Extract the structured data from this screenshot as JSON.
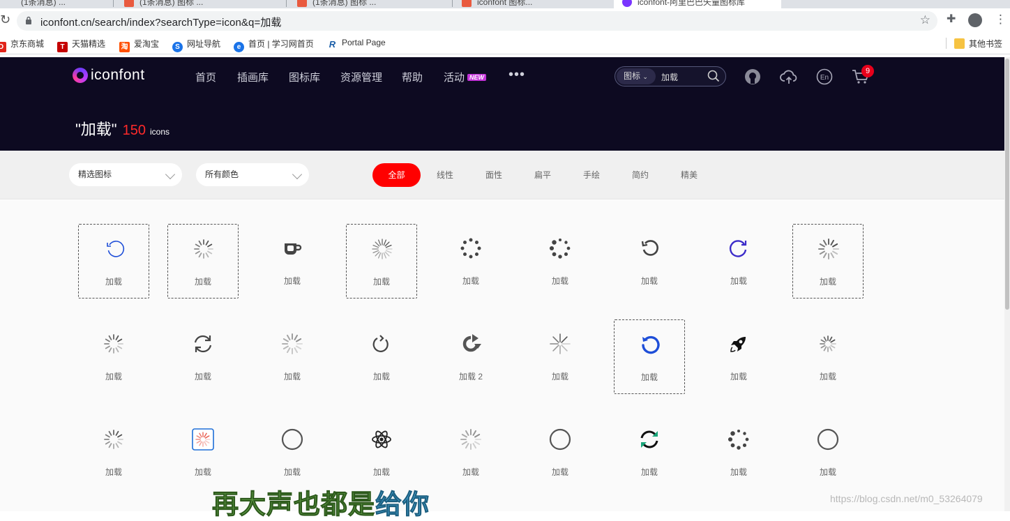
{
  "browser": {
    "tabs": [
      {
        "title": "(1条消息) ..."
      },
      {
        "title": "(1条消息) 图标 ..."
      },
      {
        "title": "(1条消息) 图标 ..."
      },
      {
        "title": "iconfont 图标..."
      },
      {
        "title": "iconfont-阿里巴巴矢量图标库"
      }
    ],
    "url": "iconfont.cn/search/index?searchType=icon&q=加载"
  },
  "bookmarks": [
    {
      "label": "京东商城",
      "icon": "jd-icon",
      "color": "#e1251b"
    },
    {
      "label": "天猫精选",
      "icon": "tmall-icon",
      "color": "#c40000"
    },
    {
      "label": "爱淘宝",
      "icon": "aitaobao-icon",
      "color": "#ff5000"
    },
    {
      "label": "网址导航",
      "icon": "nav-icon",
      "color": "#1a73e8"
    },
    {
      "label": "首页 | 学习网首页",
      "icon": "study-icon",
      "color": "#1a73e8"
    },
    {
      "label": "Portal Page",
      "icon": "portal-icon",
      "color": "#1a5ea8"
    }
  ],
  "bookmarks_other": "其他书签",
  "site": {
    "brand": "iconfont",
    "nav": [
      "首页",
      "插画库",
      "图标库",
      "资源管理",
      "帮助",
      "活动"
    ],
    "new_badge": "NEW",
    "search_type": "图标",
    "search_query": "加载",
    "cart_count": "9",
    "result_query": "\"加载\"",
    "result_count": "150",
    "result_unit": "icons"
  },
  "filters": {
    "select1": "精选图标",
    "select2": "所有颜色",
    "styles": [
      "全部",
      "线性",
      "面性",
      "扁平",
      "手绘",
      "简约",
      "精美"
    ],
    "active_style": "全部"
  },
  "icons": [
    {
      "name": "加载",
      "icon": "refresh-ccw-icon"
    },
    {
      "name": "加载",
      "icon": "spinner-lines-icon"
    },
    {
      "name": "加载",
      "icon": "cup-icon"
    },
    {
      "name": "加载",
      "icon": "spinner-burst-icon"
    },
    {
      "name": "加载",
      "icon": "spinner-dots-icon"
    },
    {
      "name": "加载",
      "icon": "spinner-dots-big-icon"
    },
    {
      "name": "加载",
      "icon": "rotate-ccw-icon"
    },
    {
      "name": "加载",
      "icon": "rotate-cw-blue-icon"
    },
    {
      "name": "加载",
      "icon": "spinner-fade-icon"
    },
    {
      "name": "加载",
      "icon": "spinner-lines-icon"
    },
    {
      "name": "加载",
      "icon": "sync-icon"
    },
    {
      "name": "加载",
      "icon": "spinner-fade-grey-icon"
    },
    {
      "name": "加载",
      "icon": "rotate-cw-icon"
    },
    {
      "name": "加载 2",
      "icon": "reload-arrow-icon"
    },
    {
      "name": "加载",
      "icon": "asterisk-spinner-icon"
    },
    {
      "name": "加载",
      "icon": "reload-blue-icon"
    },
    {
      "name": "加载",
      "icon": "rocket-icon"
    },
    {
      "name": "加载",
      "icon": "spinner-small-icon"
    },
    {
      "name": "加载",
      "icon": "spinner-lines-icon"
    },
    {
      "name": "加载",
      "icon": "spinner-box-icon"
    },
    {
      "name": "加载",
      "icon": "ring-icon"
    },
    {
      "name": "加载",
      "icon": "atom-icon"
    },
    {
      "name": "加载",
      "icon": "spinner-fade-grey-icon"
    },
    {
      "name": "加载",
      "icon": "ring-icon"
    },
    {
      "name": "加载",
      "icon": "sync-green-icon"
    },
    {
      "name": "加载",
      "icon": "spinner-dots-big-icon"
    },
    {
      "name": "加载",
      "icon": "ring-icon"
    }
  ],
  "overlay": {
    "subtitle_a": "再大声也都是",
    "subtitle_b": "给你",
    "watermark": "https://blog.csdn.net/m0_53264079"
  },
  "colors": {
    "header_bg": "#0d0a21",
    "accent_red": "#ff0000",
    "selected_blue": "#1e4ed8"
  }
}
